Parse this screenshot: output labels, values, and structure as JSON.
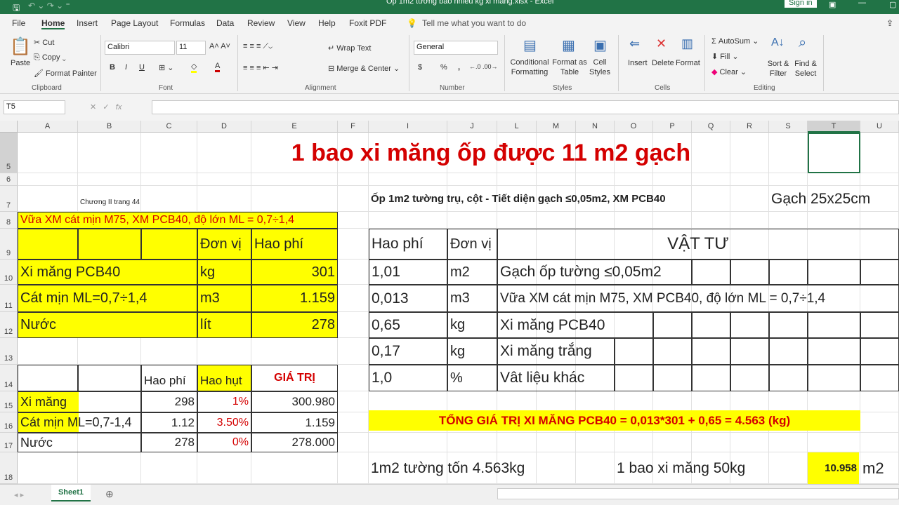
{
  "window": {
    "title": "Ốp 1m2 tường bao nhiêu kg xi măng.xlsx  -  Excel",
    "sign_in": "Sign in"
  },
  "menu": {
    "tabs": [
      "File",
      "Home",
      "Insert",
      "Page Layout",
      "Formulas",
      "Data",
      "Review",
      "View",
      "Help",
      "Foxit PDF"
    ],
    "active": "Home",
    "tell_me": "Tell me what you want to do"
  },
  "ribbon": {
    "clipboard": {
      "paste": "Paste",
      "cut": "Cut",
      "copy": "Copy",
      "format_painter": "Format Painter",
      "group": "Clipboard"
    },
    "font": {
      "name": "Calibri",
      "size": "11",
      "bold": "B",
      "italic": "I",
      "underline": "U",
      "group": "Font"
    },
    "alignment": {
      "wrap_text": "Wrap Text",
      "merge_center": "Merge & Center",
      "group": "Alignment"
    },
    "number": {
      "format": "General",
      "currency": "$",
      "percent": "%",
      "comma": ",",
      "group": "Number"
    },
    "styles": {
      "conditional": "Conditional Formatting",
      "format_table": "Format as Table",
      "cell_styles": "Cell Styles",
      "group": "Styles"
    },
    "cells": {
      "insert": "Insert",
      "delete": "Delete",
      "format": "Format",
      "group": "Cells"
    },
    "editing": {
      "autosum": "AutoSum",
      "fill": "Fill",
      "clear": "Clear",
      "sort_filter": "Sort & Filter",
      "find_select": "Find & Select",
      "group": "Editing"
    }
  },
  "formula_bar": {
    "name_box": "T5",
    "formula": ""
  },
  "columns": [
    "A",
    "B",
    "C",
    "D",
    "E",
    "F",
    "I",
    "J",
    "L",
    "M",
    "N",
    "O",
    "P",
    "Q",
    "R",
    "S",
    "T",
    "U"
  ],
  "rows": [
    "5",
    "6",
    "7",
    "8",
    "9",
    "10",
    "11",
    "12",
    "13",
    "14",
    "15",
    "16",
    "17",
    "18"
  ],
  "selected_cell": "T5",
  "sheet": {
    "title": "1 bao xi măng ốp được 11 m2 gạch",
    "note": "Chương II trang 44",
    "left_table": {
      "header": "Vữa XM cát mịn M75, XM PCB40, độ lớn ML = 0,7÷1,4",
      "col_unit": "Đơn vị",
      "col_hao_phi": "Hao phí",
      "rows": [
        {
          "name": "Xi măng PCB40",
          "unit": "kg",
          "value": "301"
        },
        {
          "name": "Cát mịn ML=0,7÷1,4",
          "unit": "m3",
          "value": "1.159"
        },
        {
          "name": "Nước",
          "unit": "lít",
          "value": "278"
        }
      ]
    },
    "calc_table": {
      "headers": [
        "Hao phí",
        "Hao hụt",
        "GIÁ TRỊ"
      ],
      "rows": [
        {
          "name": "Xi măng",
          "hao_phi": "298",
          "hao_hut": "1%",
          "gia_tri": "300.980"
        },
        {
          "name": "Cát mịn  ML=0,7-1,4",
          "hao_phi": "1.12",
          "hao_hut": "3.50%",
          "gia_tri": "1.159"
        },
        {
          "name": "Nước",
          "hao_phi": "278",
          "hao_hut": "0%",
          "gia_tri": "278.000"
        }
      ]
    },
    "right": {
      "subtitle": "Ốp 1m2 tường trụ, cột - Tiết diện gạch ≤0,05m2, XM PCB40",
      "tile": "Gạch 25x25cm",
      "headers": [
        "Hao phí",
        "Đơn vị",
        "VẬT TƯ"
      ],
      "rows": [
        {
          "hao_phi": "1,01",
          "unit": "m2",
          "material": "Gạch ốp tường ≤0,05m2"
        },
        {
          "hao_phi": "0,013",
          "unit": "m3",
          "material": "Vữa XM cát mịn M75, XM PCB40, độ lớn ML = 0,7÷1,4"
        },
        {
          "hao_phi": "0,65",
          "unit": "kg",
          "material": "Xi măng PCB40"
        },
        {
          "hao_phi": "0,17",
          "unit": "kg",
          "material": "Xi măng trắng"
        },
        {
          "hao_phi": "1,0",
          "unit": "%",
          "material": "Vât liệu khác"
        }
      ],
      "total": "TỔNG GIÁ TRỊ XI MĂNG PCB40 = 0,013*301 + 0,65  = 4.563 (kg)",
      "per_m2": "1m2 tường tốn 4.563kg",
      "bag": "1 bao xi măng 50kg",
      "result": "10.958",
      "result_unit": "m2"
    }
  },
  "sheet_tabs": [
    "Sheet1"
  ],
  "colors": {
    "excel_green": "#217346",
    "highlight": "#ffff00",
    "red": "#d40000"
  }
}
